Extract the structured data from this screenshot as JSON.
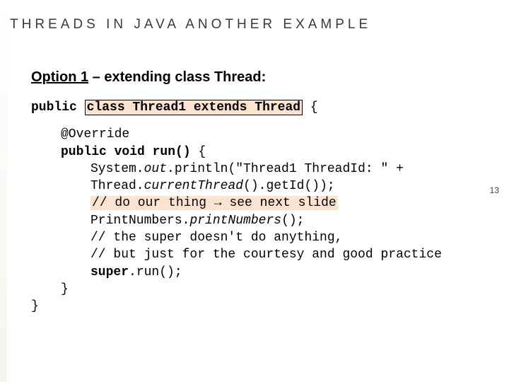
{
  "title": "THREADS IN JAVA ANOTHER EXAMPLE",
  "subtitle_underlined": "Option 1",
  "subtitle_rest": " – extending class Thread:",
  "code": {
    "l1a": "public ",
    "l1b": "class Thread1 extends Thread",
    "l1c": " {",
    "l2": "@Override",
    "l3a": "public void ",
    "l3b": "run()",
    "l3c": " {",
    "l4a": "System.",
    "l4b": "out",
    "l4c": ".println(\"Thread1 ThreadId: \" +",
    "l5a": "Thread.",
    "l5b": "currentThread",
    "l5c": "().getId());",
    "l6a": "// do our thing ",
    "l6arrow": "→",
    "l6b": " see next slide",
    "l7a": "PrintNumbers.",
    "l7b": "printNumbers",
    "l7c": "();",
    "l8": "// the super doesn't do anything,",
    "l9": "// but just for the courtesy and good practice",
    "l10a": "super",
    "l10b": ".run();",
    "l11": "}",
    "l12": "}"
  },
  "page_number": "13"
}
